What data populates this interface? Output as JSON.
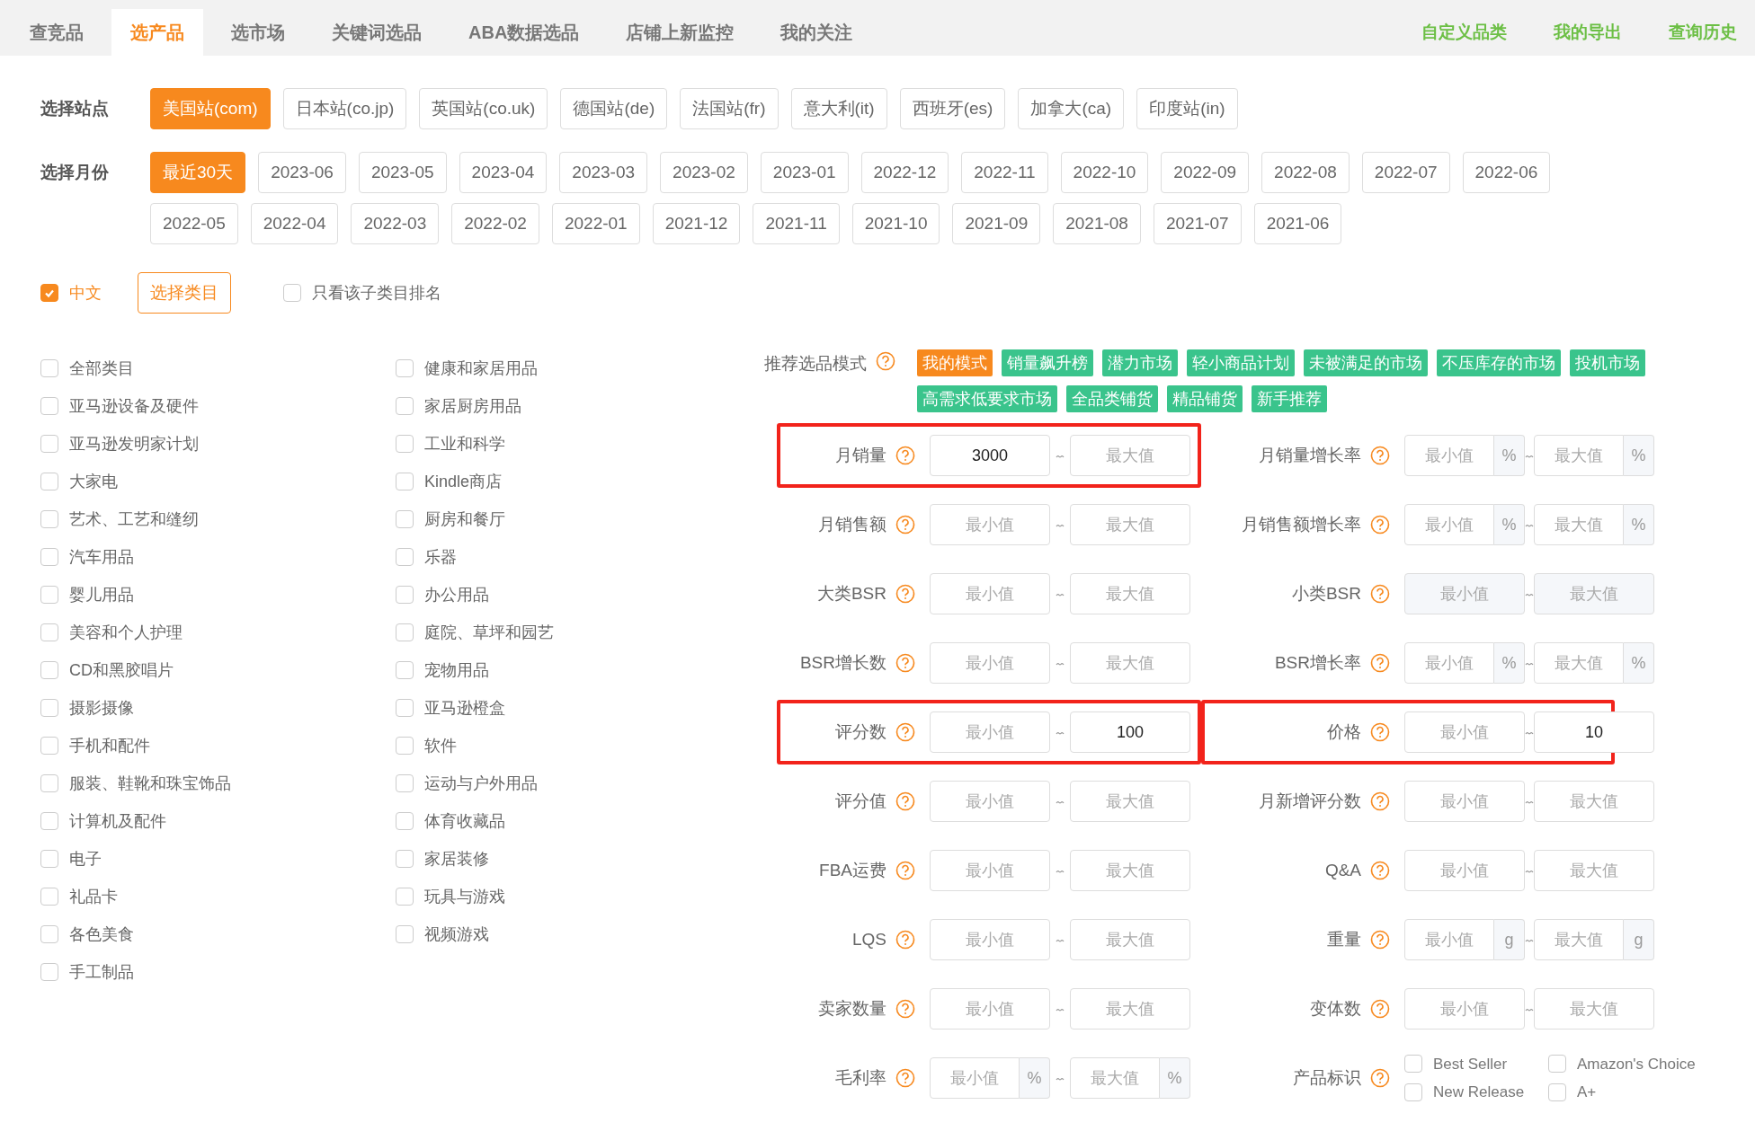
{
  "tabs": [
    {
      "label": "查竞品",
      "selected": false
    },
    {
      "label": "选产品",
      "selected": true
    },
    {
      "label": "选市场",
      "selected": false
    },
    {
      "label": "关键词选品",
      "selected": false
    },
    {
      "label": "ABA数据选品",
      "selected": false
    },
    {
      "label": "店铺上新监控",
      "selected": false
    },
    {
      "label": "我的关注",
      "selected": false
    }
  ],
  "top_links": [
    "自定义品类",
    "我的导出",
    "查询历史"
  ],
  "site": {
    "label": "选择站点",
    "options": [
      {
        "label": "美国站(com)",
        "selected": true
      },
      {
        "label": "日本站(co.jp)",
        "selected": false
      },
      {
        "label": "英国站(co.uk)",
        "selected": false
      },
      {
        "label": "德国站(de)",
        "selected": false
      },
      {
        "label": "法国站(fr)",
        "selected": false
      },
      {
        "label": "意大利(it)",
        "selected": false
      },
      {
        "label": "西班牙(es)",
        "selected": false
      },
      {
        "label": "加拿大(ca)",
        "selected": false
      },
      {
        "label": "印度站(in)",
        "selected": false
      }
    ]
  },
  "month": {
    "label": "选择月份",
    "options": [
      {
        "label": "最近30天",
        "selected": true
      },
      {
        "label": "2023-06",
        "selected": false
      },
      {
        "label": "2023-05",
        "selected": false
      },
      {
        "label": "2023-04",
        "selected": false
      },
      {
        "label": "2023-03",
        "selected": false
      },
      {
        "label": "2023-02",
        "selected": false
      },
      {
        "label": "2023-01",
        "selected": false
      },
      {
        "label": "2022-12",
        "selected": false
      },
      {
        "label": "2022-11",
        "selected": false
      },
      {
        "label": "2022-10",
        "selected": false
      },
      {
        "label": "2022-09",
        "selected": false
      },
      {
        "label": "2022-08",
        "selected": false
      },
      {
        "label": "2022-07",
        "selected": false
      },
      {
        "label": "2022-06",
        "selected": false
      },
      {
        "label": "2022-05",
        "selected": false
      },
      {
        "label": "2022-04",
        "selected": false
      },
      {
        "label": "2022-03",
        "selected": false
      },
      {
        "label": "2022-02",
        "selected": false
      },
      {
        "label": "2022-01",
        "selected": false
      },
      {
        "label": "2021-12",
        "selected": false
      },
      {
        "label": "2021-11",
        "selected": false
      },
      {
        "label": "2021-10",
        "selected": false
      },
      {
        "label": "2021-09",
        "selected": false
      },
      {
        "label": "2021-08",
        "selected": false
      },
      {
        "label": "2021-07",
        "selected": false
      },
      {
        "label": "2021-06",
        "selected": false
      }
    ]
  },
  "language": {
    "label": "中文",
    "checked": true
  },
  "category_button": "选择类目",
  "only_subcategory": {
    "label": "只看该子类目排名",
    "checked": false
  },
  "categories": [
    {
      "label": "全部类目",
      "checked": false
    },
    {
      "label": "亚马逊设备及硬件",
      "checked": false
    },
    {
      "label": "亚马逊发明家计划",
      "checked": false
    },
    {
      "label": "大家电",
      "checked": false
    },
    {
      "label": "艺术、工艺和缝纫",
      "checked": false
    },
    {
      "label": "汽车用品",
      "checked": false
    },
    {
      "label": "婴儿用品",
      "checked": false
    },
    {
      "label": "美容和个人护理",
      "checked": false
    },
    {
      "label": "CD和黑胶唱片",
      "checked": false
    },
    {
      "label": "摄影摄像",
      "checked": false
    },
    {
      "label": "手机和配件",
      "checked": false
    },
    {
      "label": "服装、鞋靴和珠宝饰品",
      "checked": false
    },
    {
      "label": "计算机及配件",
      "checked": false
    },
    {
      "label": "电子",
      "checked": false
    },
    {
      "label": "礼品卡",
      "checked": false
    },
    {
      "label": "各色美食",
      "checked": false
    },
    {
      "label": "手工制品",
      "checked": false
    },
    {
      "label": "健康和家居用品",
      "checked": false
    },
    {
      "label": "家居厨房用品",
      "checked": false
    },
    {
      "label": "工业和科学",
      "checked": false
    },
    {
      "label": "Kindle商店",
      "checked": false
    },
    {
      "label": "厨房和餐厅",
      "checked": false
    },
    {
      "label": "乐器",
      "checked": false
    },
    {
      "label": "办公用品",
      "checked": false
    },
    {
      "label": "庭院、草坪和园艺",
      "checked": false
    },
    {
      "label": "宠物用品",
      "checked": false
    },
    {
      "label": "亚马逊橙盒",
      "checked": false
    },
    {
      "label": "软件",
      "checked": false
    },
    {
      "label": "运动与户外用品",
      "checked": false
    },
    {
      "label": "体育收藏品",
      "checked": false
    },
    {
      "label": "家居装修",
      "checked": false
    },
    {
      "label": "玩具与游戏",
      "checked": false
    },
    {
      "label": "视频游戏",
      "checked": false
    }
  ],
  "recommend": {
    "label": "推荐选品模式",
    "modes": [
      {
        "label": "我的模式",
        "selected": true
      },
      {
        "label": "销量飙升榜",
        "selected": false
      },
      {
        "label": "潜力市场",
        "selected": false
      },
      {
        "label": "轻小商品计划",
        "selected": false
      },
      {
        "label": "未被满足的市场",
        "selected": false
      },
      {
        "label": "不压库存的市场",
        "selected": false
      },
      {
        "label": "投机市场",
        "selected": false
      },
      {
        "label": "高需求低要求市场",
        "selected": false
      },
      {
        "label": "全品类铺货",
        "selected": false
      },
      {
        "label": "精品铺货",
        "selected": false
      },
      {
        "label": "新手推荐",
        "selected": false
      }
    ]
  },
  "filters": [
    {
      "label": "月销量",
      "kind": "range",
      "min": {
        "value": "3000"
      },
      "max": {
        "placeholder": "最大值"
      },
      "highlighted": true,
      "disabled": false
    },
    {
      "label": "月销量增长率",
      "kind": "range",
      "min": {
        "placeholder": "最小值",
        "unit": "%"
      },
      "max": {
        "placeholder": "最大值",
        "unit": "%"
      },
      "highlighted": false,
      "disabled": false
    },
    {
      "label": "月销售额",
      "kind": "range",
      "min": {
        "placeholder": "最小值"
      },
      "max": {
        "placeholder": "最大值"
      },
      "highlighted": false,
      "disabled": false
    },
    {
      "label": "月销售额增长率",
      "kind": "range",
      "min": {
        "placeholder": "最小值",
        "unit": "%"
      },
      "max": {
        "placeholder": "最大值",
        "unit": "%"
      },
      "highlighted": false,
      "disabled": false
    },
    {
      "label": "大类BSR",
      "kind": "range",
      "min": {
        "placeholder": "最小值"
      },
      "max": {
        "placeholder": "最大值"
      },
      "highlighted": false,
      "disabled": false
    },
    {
      "label": "小类BSR",
      "kind": "range",
      "min": {
        "placeholder": "最小值"
      },
      "max": {
        "placeholder": "最大值"
      },
      "highlighted": false,
      "disabled": true
    },
    {
      "label": "BSR增长数",
      "kind": "range",
      "min": {
        "placeholder": "最小值"
      },
      "max": {
        "placeholder": "最大值"
      },
      "highlighted": false,
      "disabled": false
    },
    {
      "label": "BSR增长率",
      "kind": "range",
      "min": {
        "placeholder": "最小值",
        "unit": "%"
      },
      "max": {
        "placeholder": "最大值",
        "unit": "%"
      },
      "highlighted": false,
      "disabled": false
    },
    {
      "label": "评分数",
      "kind": "range",
      "min": {
        "placeholder": "最小值"
      },
      "max": {
        "value": "100"
      },
      "highlighted": true,
      "disabled": false
    },
    {
      "label": "价格",
      "kind": "range",
      "min": {
        "placeholder": "最小值"
      },
      "max": {
        "value": "10"
      },
      "highlighted": true,
      "disabled": false
    },
    {
      "label": "评分值",
      "kind": "range",
      "min": {
        "placeholder": "最小值"
      },
      "max": {
        "placeholder": "最大值"
      },
      "highlighted": false,
      "disabled": false
    },
    {
      "label": "月新增评分数",
      "kind": "range",
      "min": {
        "placeholder": "最小值"
      },
      "max": {
        "placeholder": "最大值"
      },
      "highlighted": false,
      "disabled": false
    },
    {
      "label": "FBA运费",
      "kind": "range",
      "min": {
        "placeholder": "最小值"
      },
      "max": {
        "placeholder": "最大值"
      },
      "highlighted": false,
      "disabled": false
    },
    {
      "label": "Q&A",
      "kind": "range",
      "min": {
        "placeholder": "最小值"
      },
      "max": {
        "placeholder": "最大值"
      },
      "highlighted": false,
      "disabled": false
    },
    {
      "label": "LQS",
      "kind": "range",
      "min": {
        "placeholder": "最小值"
      },
      "max": {
        "placeholder": "最大值"
      },
      "highlighted": false,
      "disabled": false
    },
    {
      "label": "重量",
      "kind": "range",
      "min": {
        "placeholder": "最小值",
        "unit": "g"
      },
      "max": {
        "placeholder": "最大值",
        "unit": "g"
      },
      "highlighted": false,
      "disabled": false
    },
    {
      "label": "卖家数量",
      "kind": "range",
      "min": {
        "placeholder": "最小值"
      },
      "max": {
        "placeholder": "最大值"
      },
      "highlighted": false,
      "disabled": false
    },
    {
      "label": "变体数",
      "kind": "range",
      "min": {
        "placeholder": "最小值"
      },
      "max": {
        "placeholder": "最大值"
      },
      "highlighted": false,
      "disabled": false
    },
    {
      "label": "毛利率",
      "kind": "range",
      "min": {
        "placeholder": "最小值",
        "unit": "%"
      },
      "max": {
        "placeholder": "最大值",
        "unit": "%"
      },
      "highlighted": false,
      "disabled": false
    },
    {
      "label": "产品标识",
      "kind": "flags",
      "highlighted": false,
      "options": [
        {
          "label": "Best Seller",
          "checked": false
        },
        {
          "label": "Amazon's Choice",
          "checked": false
        },
        {
          "label": "New Release",
          "checked": false
        },
        {
          "label": "A+",
          "checked": false
        }
      ]
    }
  ]
}
